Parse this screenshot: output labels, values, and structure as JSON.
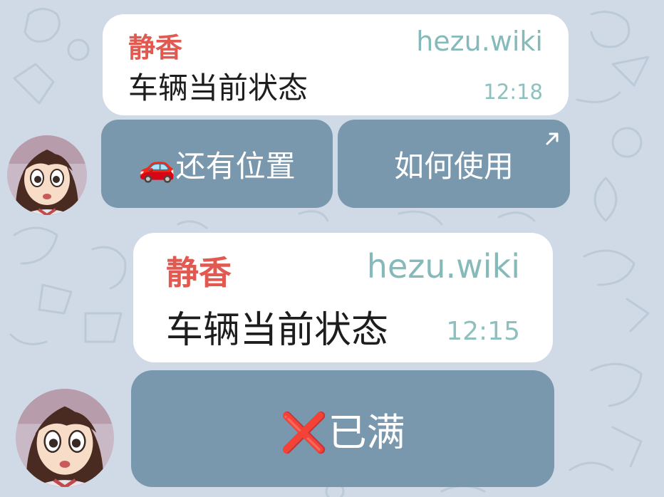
{
  "messages": [
    {
      "sender": "静香",
      "via": "hezu.wiki",
      "text": "车辆当前状态",
      "time": "12:18",
      "buttons": [
        {
          "icon": "car-icon",
          "label": "🚗还有位置"
        },
        {
          "icon": "external-link-arrow-icon",
          "label": "如何使用"
        }
      ]
    },
    {
      "sender": "静香",
      "via": "hezu.wiki",
      "text": "车辆当前状态",
      "time": "12:15",
      "buttons": [
        {
          "icon": "cross-mark-icon",
          "label": "❌已满"
        }
      ]
    }
  ],
  "colors": {
    "background": "#cfdae6",
    "sender_name": "#e05a52",
    "via_bot": "#86b9b9",
    "time": "#8fc0c0",
    "keyboard_button": "#7a98ad",
    "bubble": "#ffffff"
  }
}
